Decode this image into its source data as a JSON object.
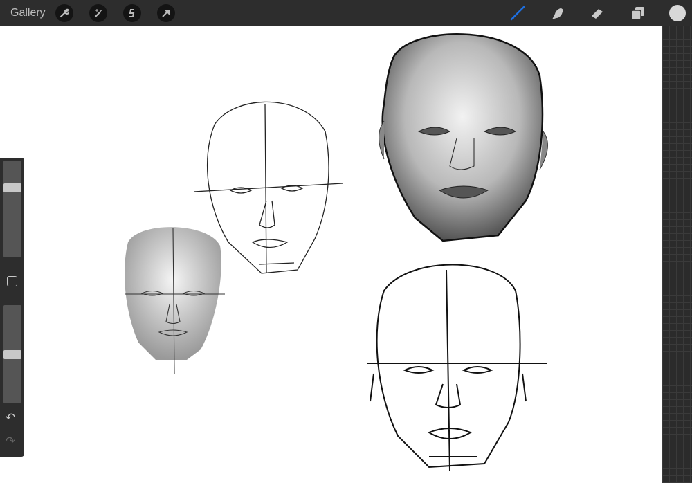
{
  "topbar": {
    "gallery_label": "Gallery",
    "left_tools": [
      "wrench-icon",
      "magic-wand-icon",
      "selection-icon",
      "transform-arrow-icon"
    ],
    "right_tools": [
      "brush-icon",
      "smudge-icon",
      "eraser-icon",
      "layers-icon"
    ],
    "active_tool": "brush",
    "accent_color": "#1e6fe0",
    "current_color": "#d8d8d8"
  },
  "sidebar": {
    "brush_size": 0.8,
    "opacity": 0.5,
    "undo_icon": "↶",
    "redo_icon": "↷"
  }
}
